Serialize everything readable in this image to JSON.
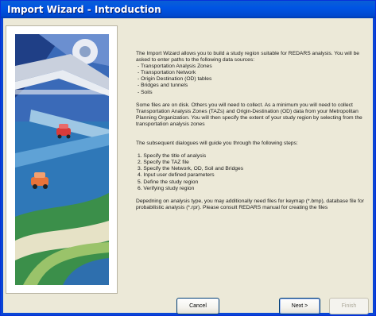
{
  "window": {
    "title": "Import Wizard - Introduction"
  },
  "intro": {
    "paragraph1": "The Import Wizard allows you to build a study region suitable for REDARS analysis. You will be asked to enter paths to the following data sources:",
    "sources": [
      "- Transportation Analysis Zones",
      "- Transportation Network",
      "- Origin Destination (OD) tables",
      "- Bridges and tunnels",
      "- Soils"
    ],
    "paragraph2": "Some files are on disk. Others you will need to collect. As a minimum you will need to collect Transportation Analysis Zones (TAZs) and Origin-Destination (OD) data from your Metropolitan Planning Organization. You will then specify the extent of your study region by selecting from the transportation analysis zones",
    "paragraph3": "The subsequent dialogues will guide you through the following steps:",
    "steps": [
      "1. Specify the title of analysis",
      "2. Specify the TAZ file",
      "3. Specify the Network, OD, Soil and Bridges",
      "4. Input user defined parameters",
      "5. Define the study region",
      "6. Verifying study region"
    ],
    "paragraph4": "Depedning on analysis type, you may additionally need files for keymap (*.bmp), database file for probabilistic analysis (*.rpr). Please consult REDARS manual for creating the files"
  },
  "buttons": {
    "cancel": "Cancel",
    "next": "Next >",
    "finish": "Finish"
  }
}
